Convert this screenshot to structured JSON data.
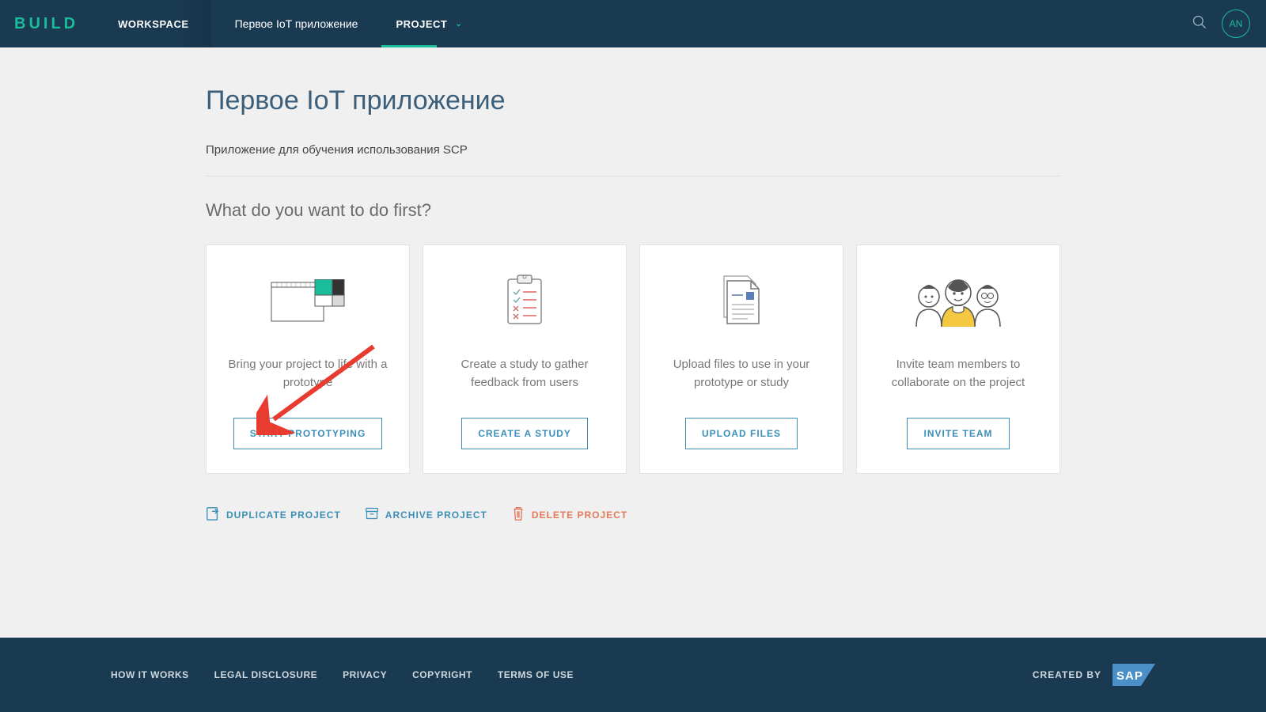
{
  "header": {
    "logo": "BUILD",
    "workspace": "WORKSPACE",
    "project_name": "Первое IoT приложение",
    "project_tab": "PROJECT",
    "avatar": "AN"
  },
  "page": {
    "title": "Первое IoT приложение",
    "subtitle": "Приложение для обучения использования SCP",
    "question": "What do you want to do first?"
  },
  "cards": [
    {
      "desc": "Bring your project to life with a prototype",
      "button": "START PROTOTYPING"
    },
    {
      "desc": "Create a study to gather feedback from users",
      "button": "CREATE A STUDY"
    },
    {
      "desc": "Upload files to use in your prototype or study",
      "button": "UPLOAD FILES"
    },
    {
      "desc": "Invite team members to collaborate on the project",
      "button": "INVITE TEAM"
    }
  ],
  "actions": {
    "duplicate": "DUPLICATE PROJECT",
    "archive": "ARCHIVE PROJECT",
    "delete": "DELETE PROJECT"
  },
  "footer": {
    "links": [
      "HOW IT WORKS",
      "LEGAL DISCLOSURE",
      "PRIVACY",
      "COPYRIGHT",
      "TERMS OF USE"
    ],
    "created_by": "CREATED BY"
  }
}
